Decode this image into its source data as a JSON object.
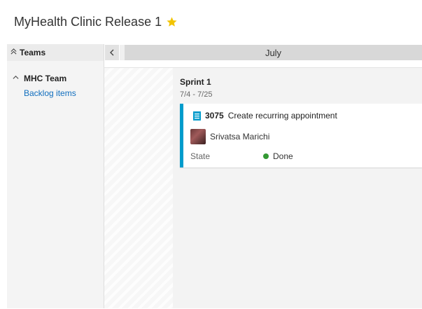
{
  "header": {
    "title": "MyHealth Clinic Release 1",
    "favorite_icon": "star-icon",
    "favorite_color": "#f2c400"
  },
  "sidebar": {
    "header_label": "Teams",
    "collapse_icon": "double-chevron-up-icon",
    "teams": [
      {
        "name": "MHC Team",
        "expand_icon": "caret-up-icon",
        "link": "Backlog items"
      }
    ]
  },
  "timeline": {
    "prev_icon": "chevron-left-icon",
    "month": "July"
  },
  "sprint": {
    "name": "Sprint 1",
    "dates": "7/4 - 7/25",
    "card": {
      "type_icon": "product-backlog-item-icon",
      "id": "3075",
      "title": "Create recurring appointment",
      "assignee": "Srivatsa Marichi",
      "state_label": "State",
      "state_value": "Done",
      "state_color": "#339933",
      "accent_color": "#009ccc"
    }
  }
}
